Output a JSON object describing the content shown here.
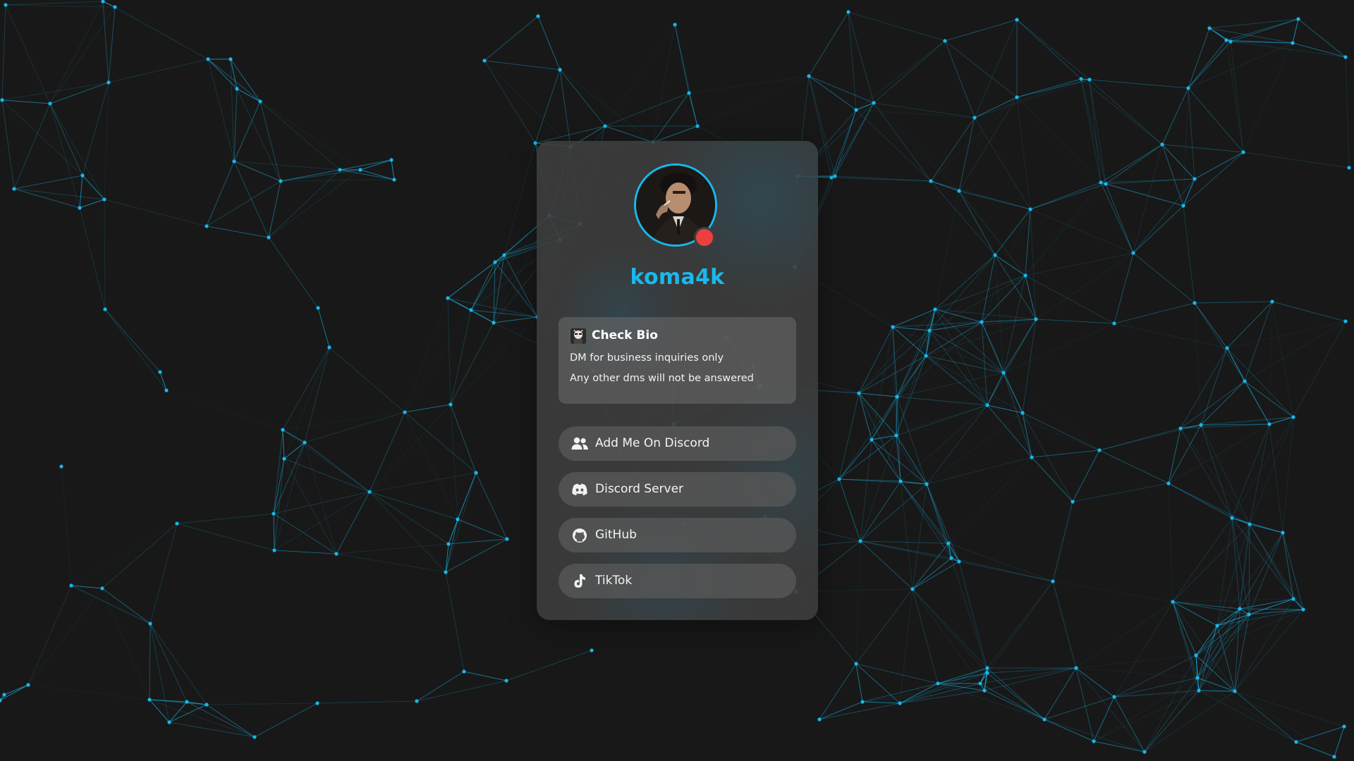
{
  "theme": {
    "background": "#181818",
    "accent": "#19b7ea",
    "status_color": "#ec4040"
  },
  "profile": {
    "username": "koma4k",
    "avatar_icon": "avatar-photo",
    "status": "dnd"
  },
  "bio": {
    "emoji_icon": "emoji-icon",
    "title": "Check Bio",
    "lines": [
      "DM for business inquiries only",
      "Any other dms will not be answered"
    ]
  },
  "links": [
    {
      "label": "Add Me On Discord",
      "icon": "users-icon"
    },
    {
      "label": "Discord Server",
      "icon": "discord-icon"
    },
    {
      "label": "GitHub",
      "icon": "github-icon"
    },
    {
      "label": "TikTok",
      "icon": "tiktok-icon"
    }
  ]
}
